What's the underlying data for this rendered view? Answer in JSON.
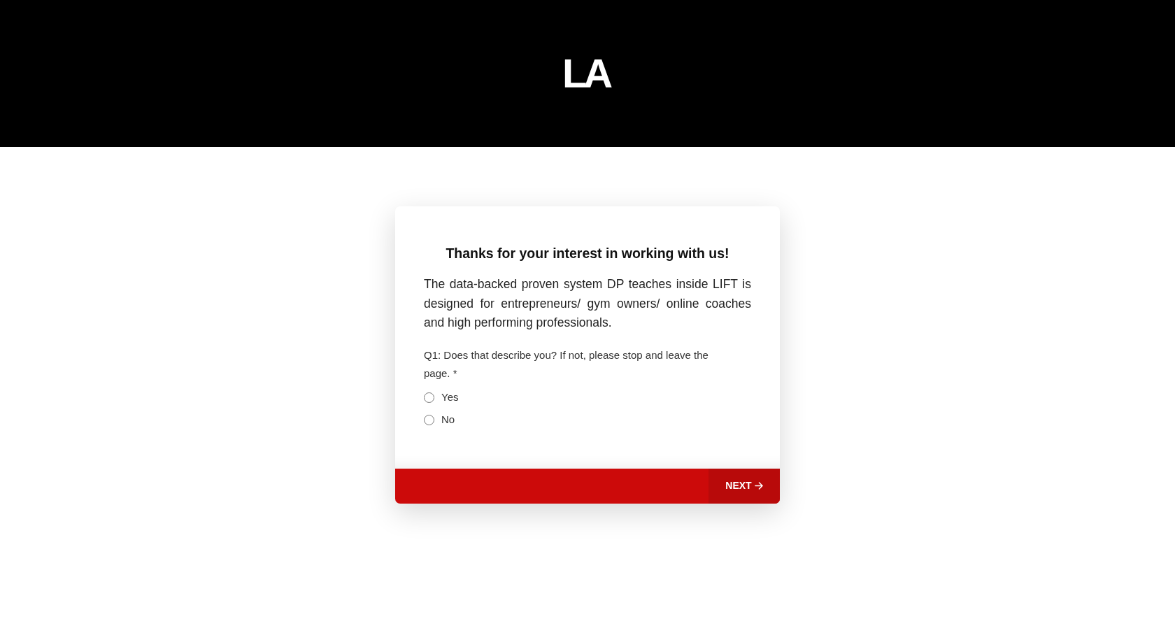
{
  "header": {
    "logo": "LA"
  },
  "card": {
    "title": "Thanks for your interest in working with us!",
    "description": "The data-backed proven system DP teaches inside LIFT is designed for entrepreneurs/ gym owners/ online coaches and high performing professionals.",
    "question": {
      "label": "Q1: Does that describe you? If not, please stop and leave the page. *",
      "options": [
        {
          "label": "Yes",
          "selected": false
        },
        {
          "label": "No",
          "selected": false
        }
      ]
    }
  },
  "footer": {
    "next_button": "NEXT"
  }
}
